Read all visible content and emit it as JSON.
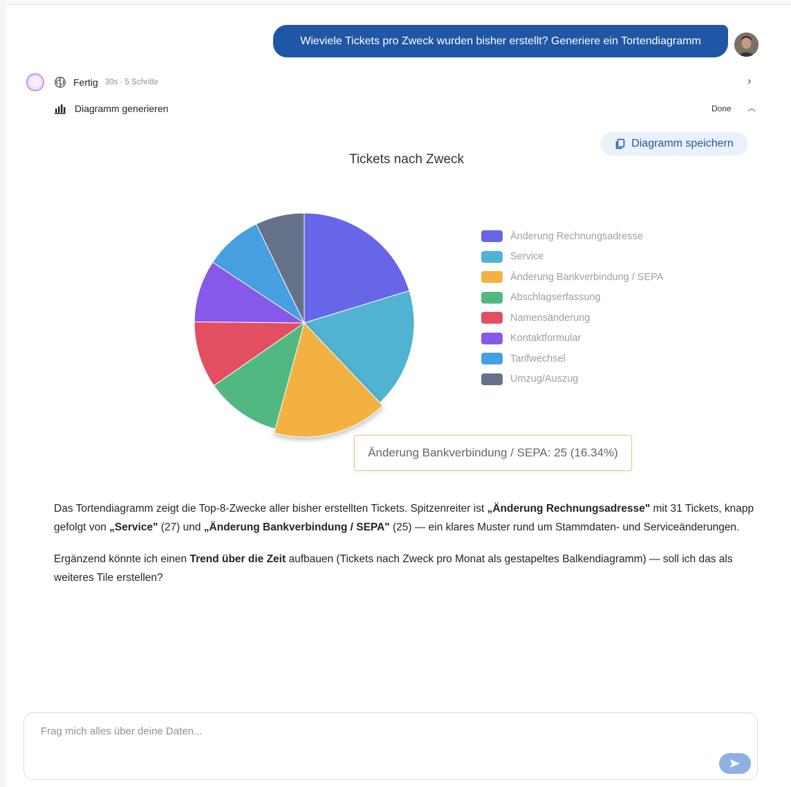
{
  "user_message": "Wieviele Tickets pro Zweck wurden bisher erstellt? Generiere ein Tortendiagramm",
  "status": {
    "label": "Fertig",
    "meta": "30s · 5 Schritte"
  },
  "tool_step": {
    "label": "Diagramm generieren",
    "state": "Done"
  },
  "save_button": "Diagramm speichern",
  "tooltip": "Änderung Bankverbindung / SEPA: 25 (16.34%)",
  "chart_data": {
    "type": "pie",
    "title": "Tickets nach Zweck",
    "legend_position": "right",
    "categories": [
      "Änderung Rechnungsadresse",
      "Service",
      "Änderung Bankverbindung / SEPA",
      "Abschlagserfassung",
      "Namensänderung",
      "Kontaktformular",
      "Tarifwechsel",
      "Umzug/Auszug"
    ],
    "values": [
      31,
      27,
      25,
      17,
      15,
      14,
      13,
      11
    ],
    "colors": [
      "#6766e9",
      "#50b3d2",
      "#f2b141",
      "#52b882",
      "#e14f60",
      "#8659ea",
      "#459fe0",
      "#66718a"
    ],
    "highlighted": "Änderung Bankverbindung / SEPA"
  },
  "answer": {
    "p1": {
      "t1": "Das Tortendiagramm zeigt die Top-8-Zwecke aller bisher erstellten Tickets. Spitzenreiter ist ",
      "b1": "„Änderung Rechnungsadresse\"",
      "t2": " mit 31 Tickets, knapp gefolgt von ",
      "b2": "„Service\"",
      "t3": " (27) und ",
      "b3": "„Änderung Bankverbindung / SEPA\"",
      "t4": " (25) — ein klares Muster rund um Stammdaten- und Serviceänderungen."
    },
    "p2": {
      "t1": "Ergänzend könnte ich einen ",
      "b1": "Trend über die Zeit",
      "t2": " aufbauen (Tickets nach Zweck pro Monat als gestapeltes Balkendiagramm) — soll ich das als weiteres Tile erstellen?"
    }
  },
  "composer": {
    "placeholder": "Frag mich alles über deine Daten..."
  },
  "icons": {
    "status": "brain-icon",
    "tool": "bar-chart-icon",
    "save": "copy-icon",
    "send": "send-icon",
    "expand": "chevron-right-icon",
    "collapse": "chevron-up-icon"
  }
}
